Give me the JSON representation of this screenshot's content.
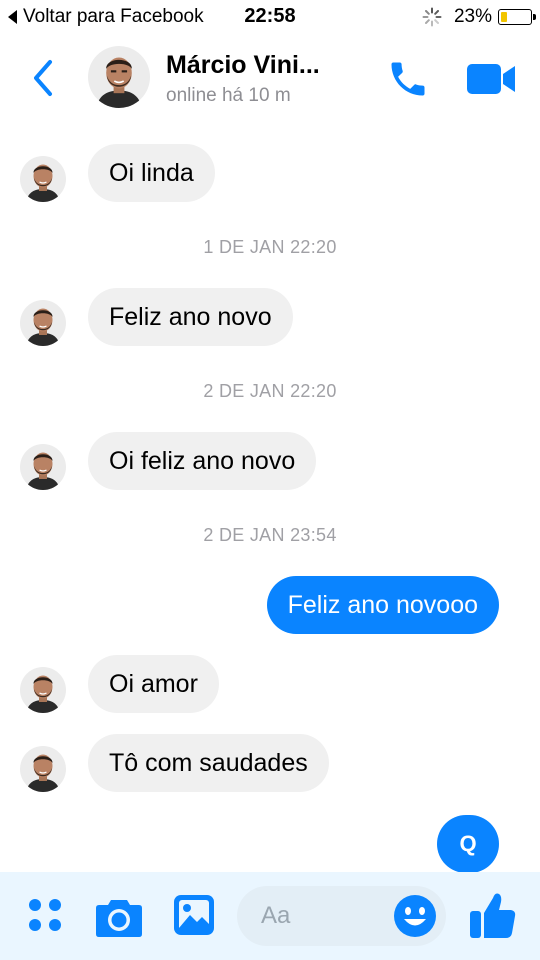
{
  "status_bar": {
    "back_app": "Voltar para Facebook",
    "time": "22:58",
    "battery": "23%",
    "battery_level": 0.23
  },
  "header": {
    "name": "Márcio Vini...",
    "status": "online há 10 m",
    "back_icon": "chevron-left-icon",
    "call_icon": "phone-icon",
    "video_icon": "video-camera-icon"
  },
  "messages": {
    "m1": "Oi linda",
    "t1": "1 DE JAN 22:20",
    "m2": "Feliz ano novo",
    "t2": "2 DE JAN 22:20",
    "m3": "Oi feliz ano novo",
    "t3": "2 DE JAN 23:54",
    "m4": "Feliz ano novooo",
    "m5": "Oi amor",
    "m6": "Tô com saudades"
  },
  "floating": {
    "label": "Q"
  },
  "composer": {
    "placeholder": "Aa",
    "icons": [
      "four-dots-menu-icon",
      "camera-icon",
      "image-gallery-icon",
      "smiley-icon",
      "thumbs-up-icon"
    ]
  },
  "colors": {
    "accent": "#0a84ff",
    "incoming_bubble": "#f0f0f0",
    "timestamp": "#a0a0a5",
    "composer_bg": "#eaf6ff"
  }
}
